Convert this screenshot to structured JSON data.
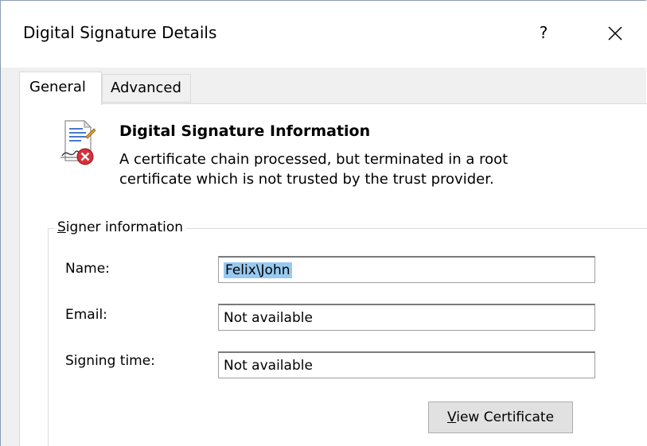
{
  "window": {
    "title": "Digital Signature Details",
    "help_label": "?",
    "close_label": "close"
  },
  "tabs": [
    {
      "label": "General",
      "selected": true
    },
    {
      "label": "Advanced",
      "selected": false
    }
  ],
  "info": {
    "icon": "signature-certificate-error-icon",
    "title": "Digital Signature Information",
    "line1": "A certificate chain processed, but terminated in a root",
    "line2": "certificate which is not trusted by the trust provider."
  },
  "signer": {
    "legend_mnemonic": "S",
    "legend_rest": "igner information",
    "fields": [
      {
        "label": "Name:",
        "value": "Felix\\John",
        "selected": true
      },
      {
        "label": "Email:",
        "value": "Not available"
      },
      {
        "label": "Signing time:",
        "value": "Not available"
      }
    ]
  },
  "view_certificate": {
    "mnemonic": "V",
    "rest": "iew Certificate"
  },
  "colors": {
    "selection": "#99c9ef",
    "window_bg": "#f0f0f0",
    "panel_bg": "#ffffff",
    "error_red": "#d9303a"
  }
}
